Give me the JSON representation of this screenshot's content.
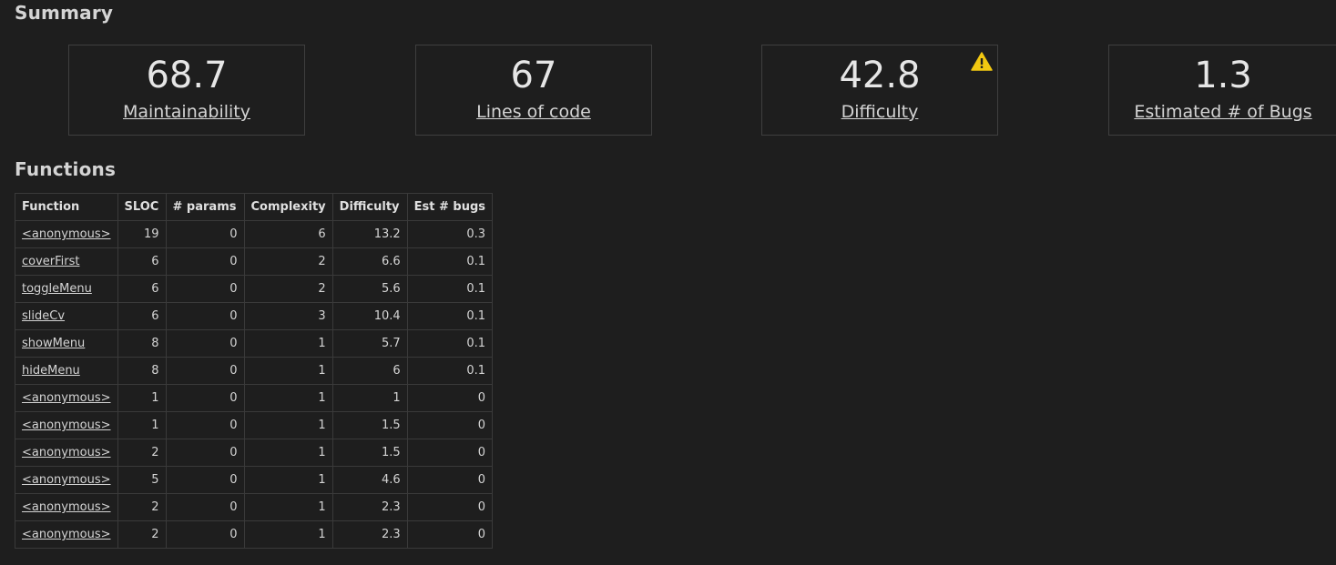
{
  "summary": {
    "heading": "Summary",
    "cards": [
      {
        "value": "68.7",
        "label": "Maintainability",
        "warning": false
      },
      {
        "value": "67",
        "label": "Lines of code",
        "warning": false
      },
      {
        "value": "42.8",
        "label": "Difficulty",
        "warning": true
      },
      {
        "value": "1.3",
        "label": "Estimated # of Bugs",
        "warning": false
      }
    ],
    "warning_icon": "warning-triangle-icon",
    "warning_color": "#f2c811"
  },
  "functions": {
    "heading": "Functions",
    "columns": [
      "Function",
      "SLOC",
      "# params",
      "Complexity",
      "Difficulty",
      "Est # bugs"
    ],
    "rows": [
      [
        "<anonymous>",
        "19",
        "0",
        "6",
        "13.2",
        "0.3"
      ],
      [
        "coverFirst",
        "6",
        "0",
        "2",
        "6.6",
        "0.1"
      ],
      [
        "toggleMenu",
        "6",
        "0",
        "2",
        "5.6",
        "0.1"
      ],
      [
        "slideCv",
        "6",
        "0",
        "3",
        "10.4",
        "0.1"
      ],
      [
        "showMenu",
        "8",
        "0",
        "1",
        "5.7",
        "0.1"
      ],
      [
        "hideMenu",
        "8",
        "0",
        "1",
        "6",
        "0.1"
      ],
      [
        "<anonymous>",
        "1",
        "0",
        "1",
        "1",
        "0"
      ],
      [
        "<anonymous>",
        "1",
        "0",
        "1",
        "1.5",
        "0"
      ],
      [
        "<anonymous>",
        "2",
        "0",
        "1",
        "1.5",
        "0"
      ],
      [
        "<anonymous>",
        "5",
        "0",
        "1",
        "4.6",
        "0"
      ],
      [
        "<anonymous>",
        "2",
        "0",
        "1",
        "2.3",
        "0"
      ],
      [
        "<anonymous>",
        "2",
        "0",
        "1",
        "2.3",
        "0"
      ]
    ]
  }
}
